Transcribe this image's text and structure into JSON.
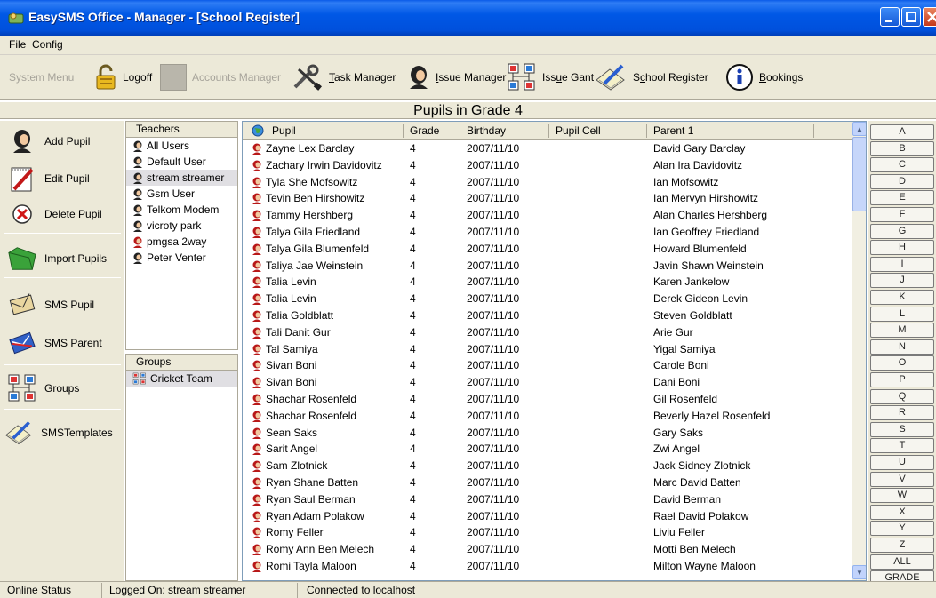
{
  "window": {
    "title": "EasySMS Office - Manager - [School Register]"
  },
  "menu": {
    "file": "File",
    "config": "Config"
  },
  "toolbar": {
    "system_menu": "System Menu",
    "logoff": "Logoff",
    "accounts_manager": "Accounts Manager",
    "task_manager_u": "T",
    "task_manager_rest": "ask Manager",
    "issue_manager_u": "I",
    "issue_manager_rest": "ssue Manager",
    "issue_gant_pre": "Iss",
    "issue_gant_u": "u",
    "issue_gant_rest": "e Gant",
    "school_register_pre": "S",
    "school_register_u": "c",
    "school_register_rest": "hool Register",
    "bookings_u": "B",
    "bookings_rest": "ookings"
  },
  "page_title": "Pupils in Grade 4",
  "actions": {
    "add_pupil": "Add Pupil",
    "edit_pupil": "Edit Pupil",
    "delete_pupil": "Delete Pupil",
    "import_pupils": "Import Pupils",
    "sms_pupil": "SMS Pupil",
    "sms_parent": "SMS Parent",
    "groups": "Groups",
    "sms_templates": "SMSTemplates"
  },
  "teachers": {
    "header": "Teachers",
    "items": [
      "All Users",
      "Default User",
      "stream streamer",
      "Gsm User",
      "Telkom Modem",
      "vicroty park",
      "pmgsa 2way",
      "Peter Venter"
    ]
  },
  "groups": {
    "header": "Groups",
    "items": [
      "Cricket Team"
    ]
  },
  "grid": {
    "columns": [
      "Pupil",
      "Grade",
      "Birthday",
      "Pupil Cell",
      "Parent 1"
    ],
    "rows": [
      [
        "Zayne Lex Barclay",
        "4",
        "2007/11/10",
        "",
        "David Gary Barclay"
      ],
      [
        "Zachary Irwin Davidovitz",
        "4",
        "2007/11/10",
        "",
        "Alan Ira Davidovitz"
      ],
      [
        "Tyla She Mofsowitz",
        "4",
        "2007/11/10",
        "",
        "Ian Mofsowitz"
      ],
      [
        "Tevin Ben Hirshowitz",
        "4",
        "2007/11/10",
        "",
        "Ian Mervyn Hirshowitz"
      ],
      [
        "Tammy Hershberg",
        "4",
        "2007/11/10",
        "",
        "Alan Charles Hershberg"
      ],
      [
        "Talya Gila Friedland",
        "4",
        "2007/11/10",
        "",
        "Ian Geoffrey Friedland"
      ],
      [
        "Talya Gila Blumenfeld",
        "4",
        "2007/11/10",
        "",
        "Howard Blumenfeld"
      ],
      [
        "Taliya Jae Weinstein",
        "4",
        "2007/11/10",
        "",
        "Javin Shawn Weinstein"
      ],
      [
        "Talia Levin",
        "4",
        "2007/11/10",
        "",
        "Karen Jankelow"
      ],
      [
        "Talia Levin",
        "4",
        "2007/11/10",
        "",
        "Derek Gideon Levin"
      ],
      [
        "Talia Goldblatt",
        "4",
        "2007/11/10",
        "",
        "Steven Goldblatt"
      ],
      [
        "Tali Danit Gur",
        "4",
        "2007/11/10",
        "",
        "Arie Gur"
      ],
      [
        "Tal Samiya",
        "4",
        "2007/11/10",
        "",
        "Yigal Samiya"
      ],
      [
        "Sivan Boni",
        "4",
        "2007/11/10",
        "",
        "Carole Boni"
      ],
      [
        "Sivan Boni",
        "4",
        "2007/11/10",
        "",
        "Dani Boni"
      ],
      [
        "Shachar Rosenfeld",
        "4",
        "2007/11/10",
        "",
        "Gil Rosenfeld"
      ],
      [
        "Shachar Rosenfeld",
        "4",
        "2007/11/10",
        "",
        "Beverly Hazel Rosenfeld"
      ],
      [
        "Sean Saks",
        "4",
        "2007/11/10",
        "",
        "Gary Saks"
      ],
      [
        "Sarit Angel",
        "4",
        "2007/11/10",
        "",
        "Zwi Angel"
      ],
      [
        "Sam Zlotnick",
        "4",
        "2007/11/10",
        "",
        "Jack Sidney Zlotnick"
      ],
      [
        "Ryan Shane Batten",
        "4",
        "2007/11/10",
        "",
        "Marc David Batten"
      ],
      [
        "Ryan Saul Berman",
        "4",
        "2007/11/10",
        "",
        "David Berman"
      ],
      [
        "Ryan Adam Polakow",
        "4",
        "2007/11/10",
        "",
        "Rael David Polakow"
      ],
      [
        "Romy Feller",
        "4",
        "2007/11/10",
        "",
        "Liviu Feller"
      ],
      [
        "Romy Ann Ben Melech",
        "4",
        "2007/11/10",
        "",
        "Motti Ben Melech"
      ],
      [
        "Romi Tayla Maloon",
        "4",
        "2007/11/10",
        "",
        "Milton Wayne Maloon"
      ]
    ]
  },
  "alphabet": [
    "A",
    "B",
    "C",
    "D",
    "E",
    "F",
    "G",
    "H",
    "I",
    "J",
    "K",
    "L",
    "M",
    "N",
    "O",
    "P",
    "Q",
    "R",
    "S",
    "T",
    "U",
    "V",
    "W",
    "X",
    "Y",
    "Z",
    "ALL",
    "GRADE"
  ],
  "status": {
    "online": "Online Status",
    "logged_on": "Logged On: stream streamer",
    "connected": "Connected to localhost"
  },
  "colors": {
    "titlebar": "#0054e3",
    "chrome": "#ece9d8",
    "grid_border": "#7f9db9"
  }
}
